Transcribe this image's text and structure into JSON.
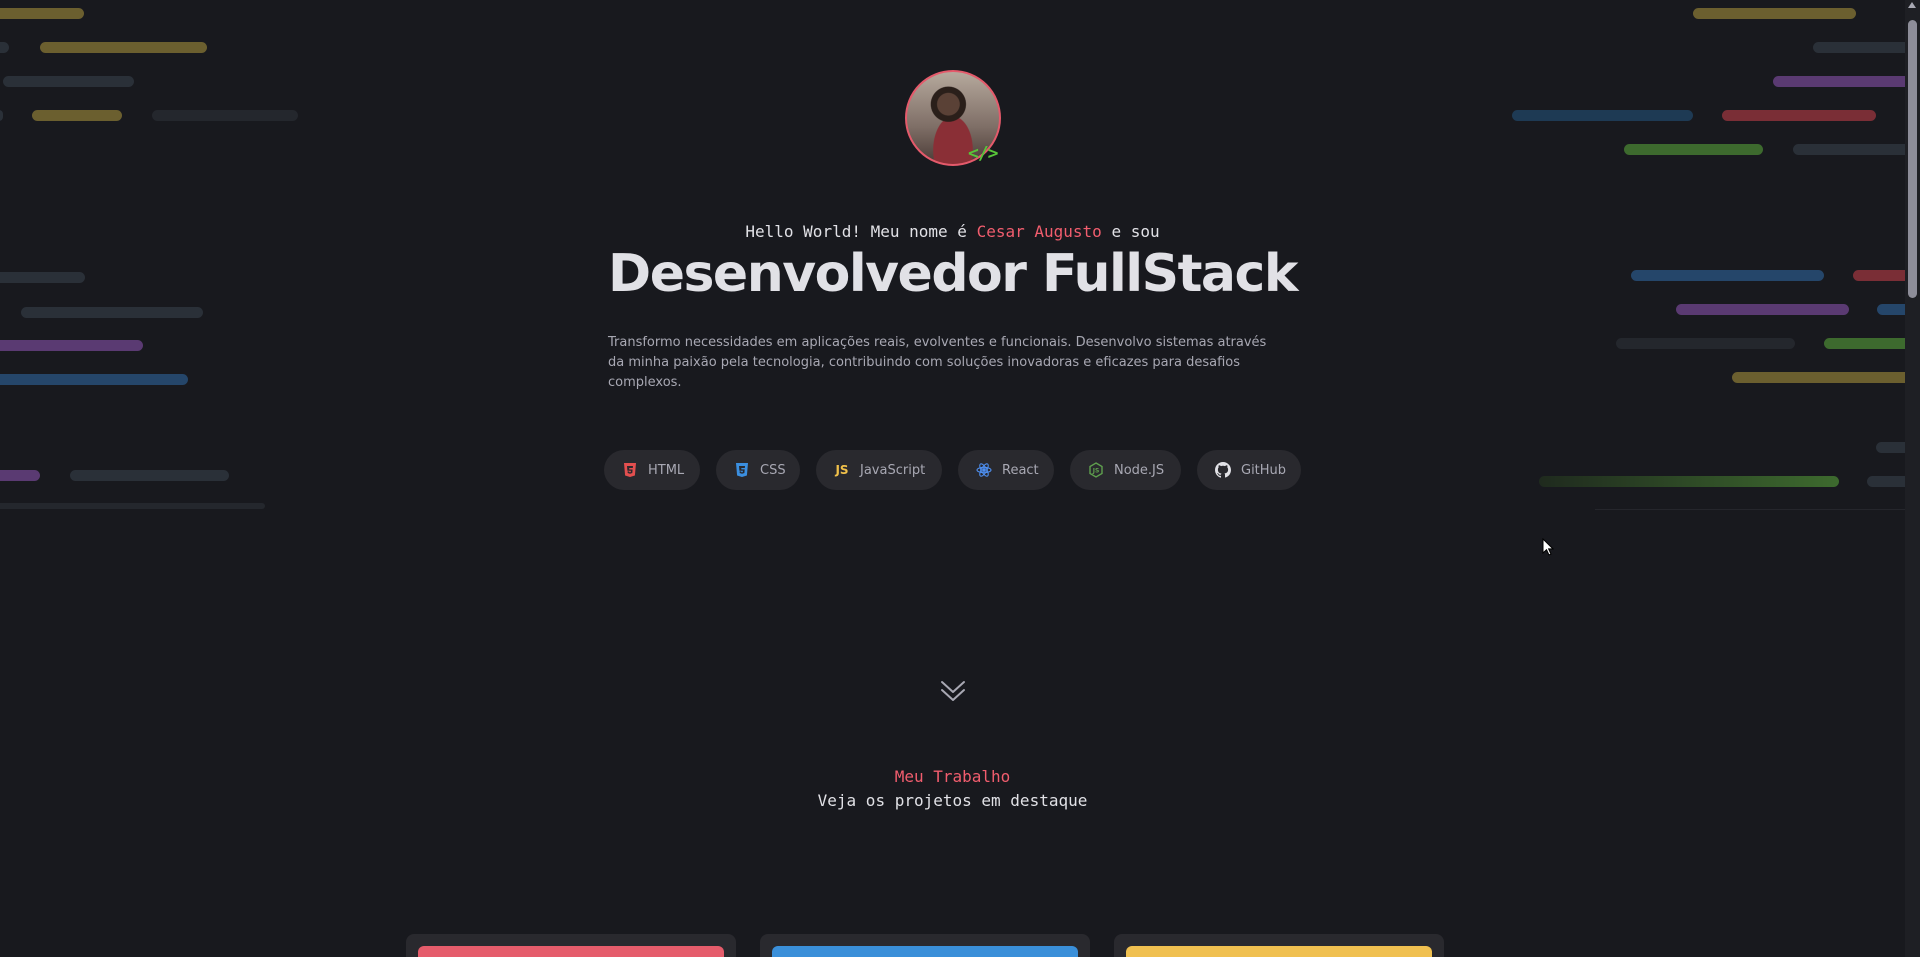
{
  "hero": {
    "greeting_prefix": "Hello World! Meu nome é",
    "name": "Cesar Augusto",
    "greeting_suffix": "e sou",
    "role": "Desenvolvedor FullStack",
    "description_line1": "Transformo necessidades em aplicações reais, evolventes e funcionais. Desenvolvo sistemas através",
    "description_line2": "da minha paixão pela tecnologia, contribuindo com soluções inovadoras e eficazes para desafios complexos.",
    "avatar_code": "</>"
  },
  "skills": [
    {
      "label": "HTML",
      "icon": "html5-icon",
      "color": "#e34f4f"
    },
    {
      "label": "CSS",
      "icon": "css3-icon",
      "color": "#3b8fe0"
    },
    {
      "label": "JavaScript",
      "icon": "js-icon",
      "color": "#f0c04a",
      "glyph": "JS"
    },
    {
      "label": "React",
      "icon": "react-icon",
      "color": "#4e8ff0"
    },
    {
      "label": "Node.JS",
      "icon": "nodejs-icon",
      "color": "#5fa04e"
    },
    {
      "label": "GitHub",
      "icon": "github-icon",
      "color": "#e1e1e6"
    }
  ],
  "projects_section": {
    "label": "Meu Trabalho",
    "subtitle": "Veja os projetos em destaque"
  },
  "project_cards": [
    {
      "accent": "#e55c6b"
    },
    {
      "accent": "#3a8fd9"
    },
    {
      "accent": "#f0c050"
    }
  ],
  "colors": {
    "background": "#18191e",
    "accent": "#f15d6e",
    "text": "#e1e1e6",
    "muted": "#a8a8b3"
  }
}
